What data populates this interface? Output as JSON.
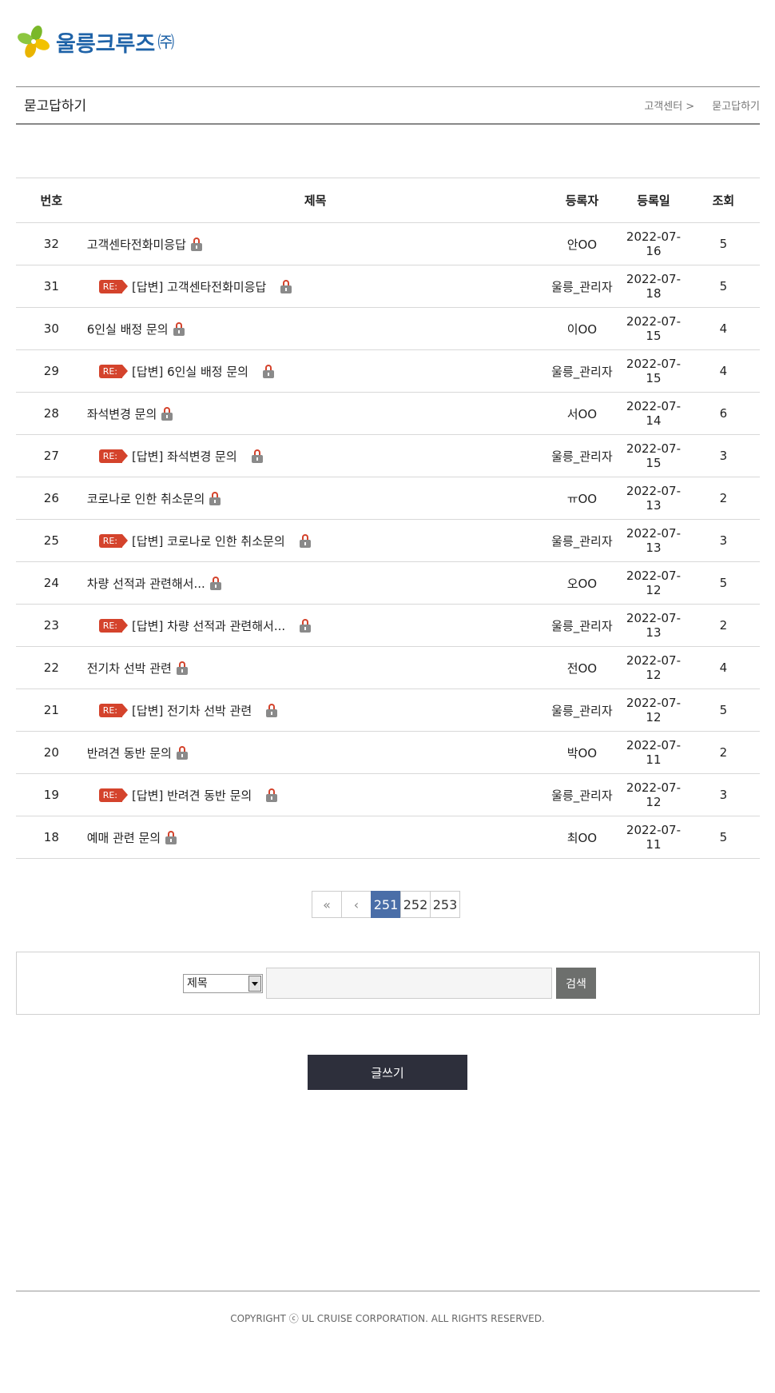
{
  "brand": {
    "name": "울릉크루즈",
    "suffix": "㈜",
    "colors": {
      "primary": "#1f63a8",
      "leaf_green": "#7ab829",
      "leaf_yellow": "#f2c200"
    }
  },
  "header": {
    "title": "묻고답하기",
    "breadcrumb": [
      "고객센터 >",
      "묻고답하기"
    ]
  },
  "table": {
    "columns": [
      "번호",
      "제목",
      "등록자",
      "등록일",
      "조회"
    ],
    "rows": [
      {
        "no": "32",
        "title": "고객센타전화미응답",
        "reply": false,
        "writer": "안OO",
        "date": "2022-07-16",
        "views": "5"
      },
      {
        "no": "31",
        "title": "[답변] 고객센타전화미응답",
        "reply": true,
        "writer": "울릉_관리자",
        "date": "2022-07-18",
        "views": "5"
      },
      {
        "no": "30",
        "title": "6인실 배정 문의",
        "reply": false,
        "writer": "이OO",
        "date": "2022-07-15",
        "views": "4"
      },
      {
        "no": "29",
        "title": "[답변] 6인실 배정 문의",
        "reply": true,
        "writer": "울릉_관리자",
        "date": "2022-07-15",
        "views": "4"
      },
      {
        "no": "28",
        "title": "좌석변경 문의",
        "reply": false,
        "writer": "서OO",
        "date": "2022-07-14",
        "views": "6"
      },
      {
        "no": "27",
        "title": "[답변] 좌석변경 문의",
        "reply": true,
        "writer": "울릉_관리자",
        "date": "2022-07-15",
        "views": "3"
      },
      {
        "no": "26",
        "title": "코로나로 인한 취소문의",
        "reply": false,
        "writer": "ㅠOO",
        "date": "2022-07-13",
        "views": "2"
      },
      {
        "no": "25",
        "title": "[답변] 코로나로 인한 취소문의",
        "reply": true,
        "writer": "울릉_관리자",
        "date": "2022-07-13",
        "views": "3"
      },
      {
        "no": "24",
        "title": "차량 선적과 관련해서...",
        "reply": false,
        "writer": "오OO",
        "date": "2022-07-12",
        "views": "5"
      },
      {
        "no": "23",
        "title": "[답변] 차량 선적과 관련해서...",
        "reply": true,
        "writer": "울릉_관리자",
        "date": "2022-07-13",
        "views": "2"
      },
      {
        "no": "22",
        "title": "전기차 선박 관련",
        "reply": false,
        "writer": "전OO",
        "date": "2022-07-12",
        "views": "4"
      },
      {
        "no": "21",
        "title": "[답변] 전기차 선박 관련",
        "reply": true,
        "writer": "울릉_관리자",
        "date": "2022-07-12",
        "views": "5"
      },
      {
        "no": "20",
        "title": "반려견 동반 문의",
        "reply": false,
        "writer": "박OO",
        "date": "2022-07-11",
        "views": "2"
      },
      {
        "no": "19",
        "title": "[답변] 반려견 동반 문의",
        "reply": true,
        "writer": "울릉_관리자",
        "date": "2022-07-12",
        "views": "3"
      },
      {
        "no": "18",
        "title": "예매 관련 문의",
        "reply": false,
        "writer": "최OO",
        "date": "2022-07-11",
        "views": "5"
      }
    ],
    "reply_badge": "RE:",
    "badge_color": "#d4432c",
    "lock_icon": "lock-icon"
  },
  "pagination": {
    "first": "«",
    "prev": "‹",
    "pages": [
      "251",
      "252",
      "253"
    ],
    "current": "251",
    "active_color": "#4a6ea8"
  },
  "search": {
    "field_selected": "제목",
    "input_value": "",
    "button_label": "검색"
  },
  "write_button": "글쓰기",
  "footer": {
    "copyright": "COPYRIGHT ⓒ UL CRUISE CORPORATION. ALL RIGHTS RESERVED."
  }
}
